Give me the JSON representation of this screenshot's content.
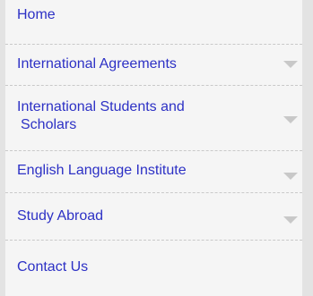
{
  "nav": {
    "items": [
      {
        "label": "Home"
      },
      {
        "label": "International Agreements"
      },
      {
        "label_line1": "International Students and",
        "label_line2": "Scholars"
      },
      {
        "label": "English Language Institute"
      },
      {
        "label": "Study Abroad"
      },
      {
        "label": "Contact Us"
      }
    ]
  }
}
